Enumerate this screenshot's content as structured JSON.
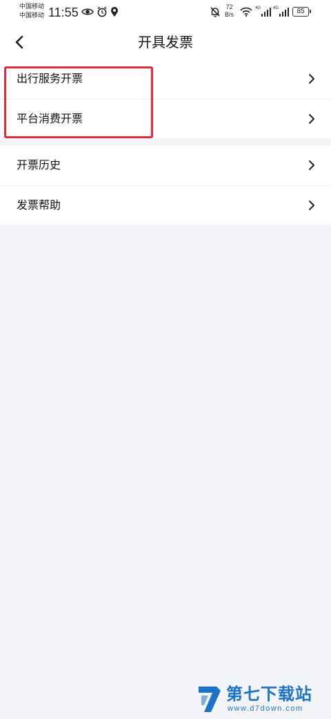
{
  "status_bar": {
    "carrier_1": "中国移动",
    "carrier_2": "中国移动",
    "time": "11:55",
    "net_speed_value": "72",
    "net_speed_unit": "B/s",
    "signal_1_label": "4G",
    "signal_2_label": "4G",
    "battery": "85",
    "icons": [
      "eye-icon",
      "alarm-icon",
      "location-icon",
      "bell-off-icon",
      "wifi-icon",
      "signal-icon",
      "signal-icon",
      "battery-icon"
    ]
  },
  "nav": {
    "title": "开具发票",
    "back_icon": "chevron-left-icon"
  },
  "menu_group_1": {
    "items": [
      {
        "label": "出行服务开票"
      },
      {
        "label": "平台消费开票"
      }
    ]
  },
  "menu_group_2": {
    "items": [
      {
        "label": "开票历史"
      },
      {
        "label": "发票帮助"
      }
    ]
  },
  "watermark": {
    "name": "第七下载站",
    "url": "www.d7down.com"
  },
  "colors": {
    "background": "#f2f4f7",
    "highlight": "#e2293a",
    "watermark": "#1a73c8"
  }
}
